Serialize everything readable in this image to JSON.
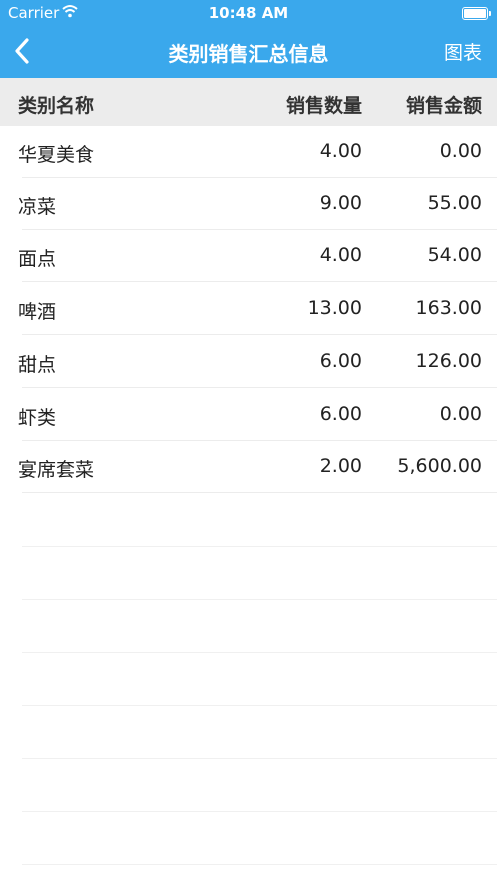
{
  "status_bar": {
    "carrier": "Carrier",
    "time": "10:48 AM"
  },
  "nav": {
    "title": "类别销售汇总信息",
    "chart_label": "图表"
  },
  "table": {
    "headers": [
      "类别名称",
      "销售数量",
      "销售金额"
    ],
    "rows": [
      [
        "华夏美食",
        "4.00",
        "0.00"
      ],
      [
        "凉菜",
        "9.00",
        "55.00"
      ],
      [
        "面点",
        "4.00",
        "54.00"
      ],
      [
        "啤酒",
        "13.00",
        "163.00"
      ],
      [
        "甜点",
        "6.00",
        "126.00"
      ],
      [
        "虾类",
        "6.00",
        "0.00"
      ],
      [
        "宴席套菜",
        "2.00",
        "5,600.00"
      ]
    ]
  },
  "colors": {
    "accent": "#3aa8ec",
    "header_bg": "#ececec"
  }
}
